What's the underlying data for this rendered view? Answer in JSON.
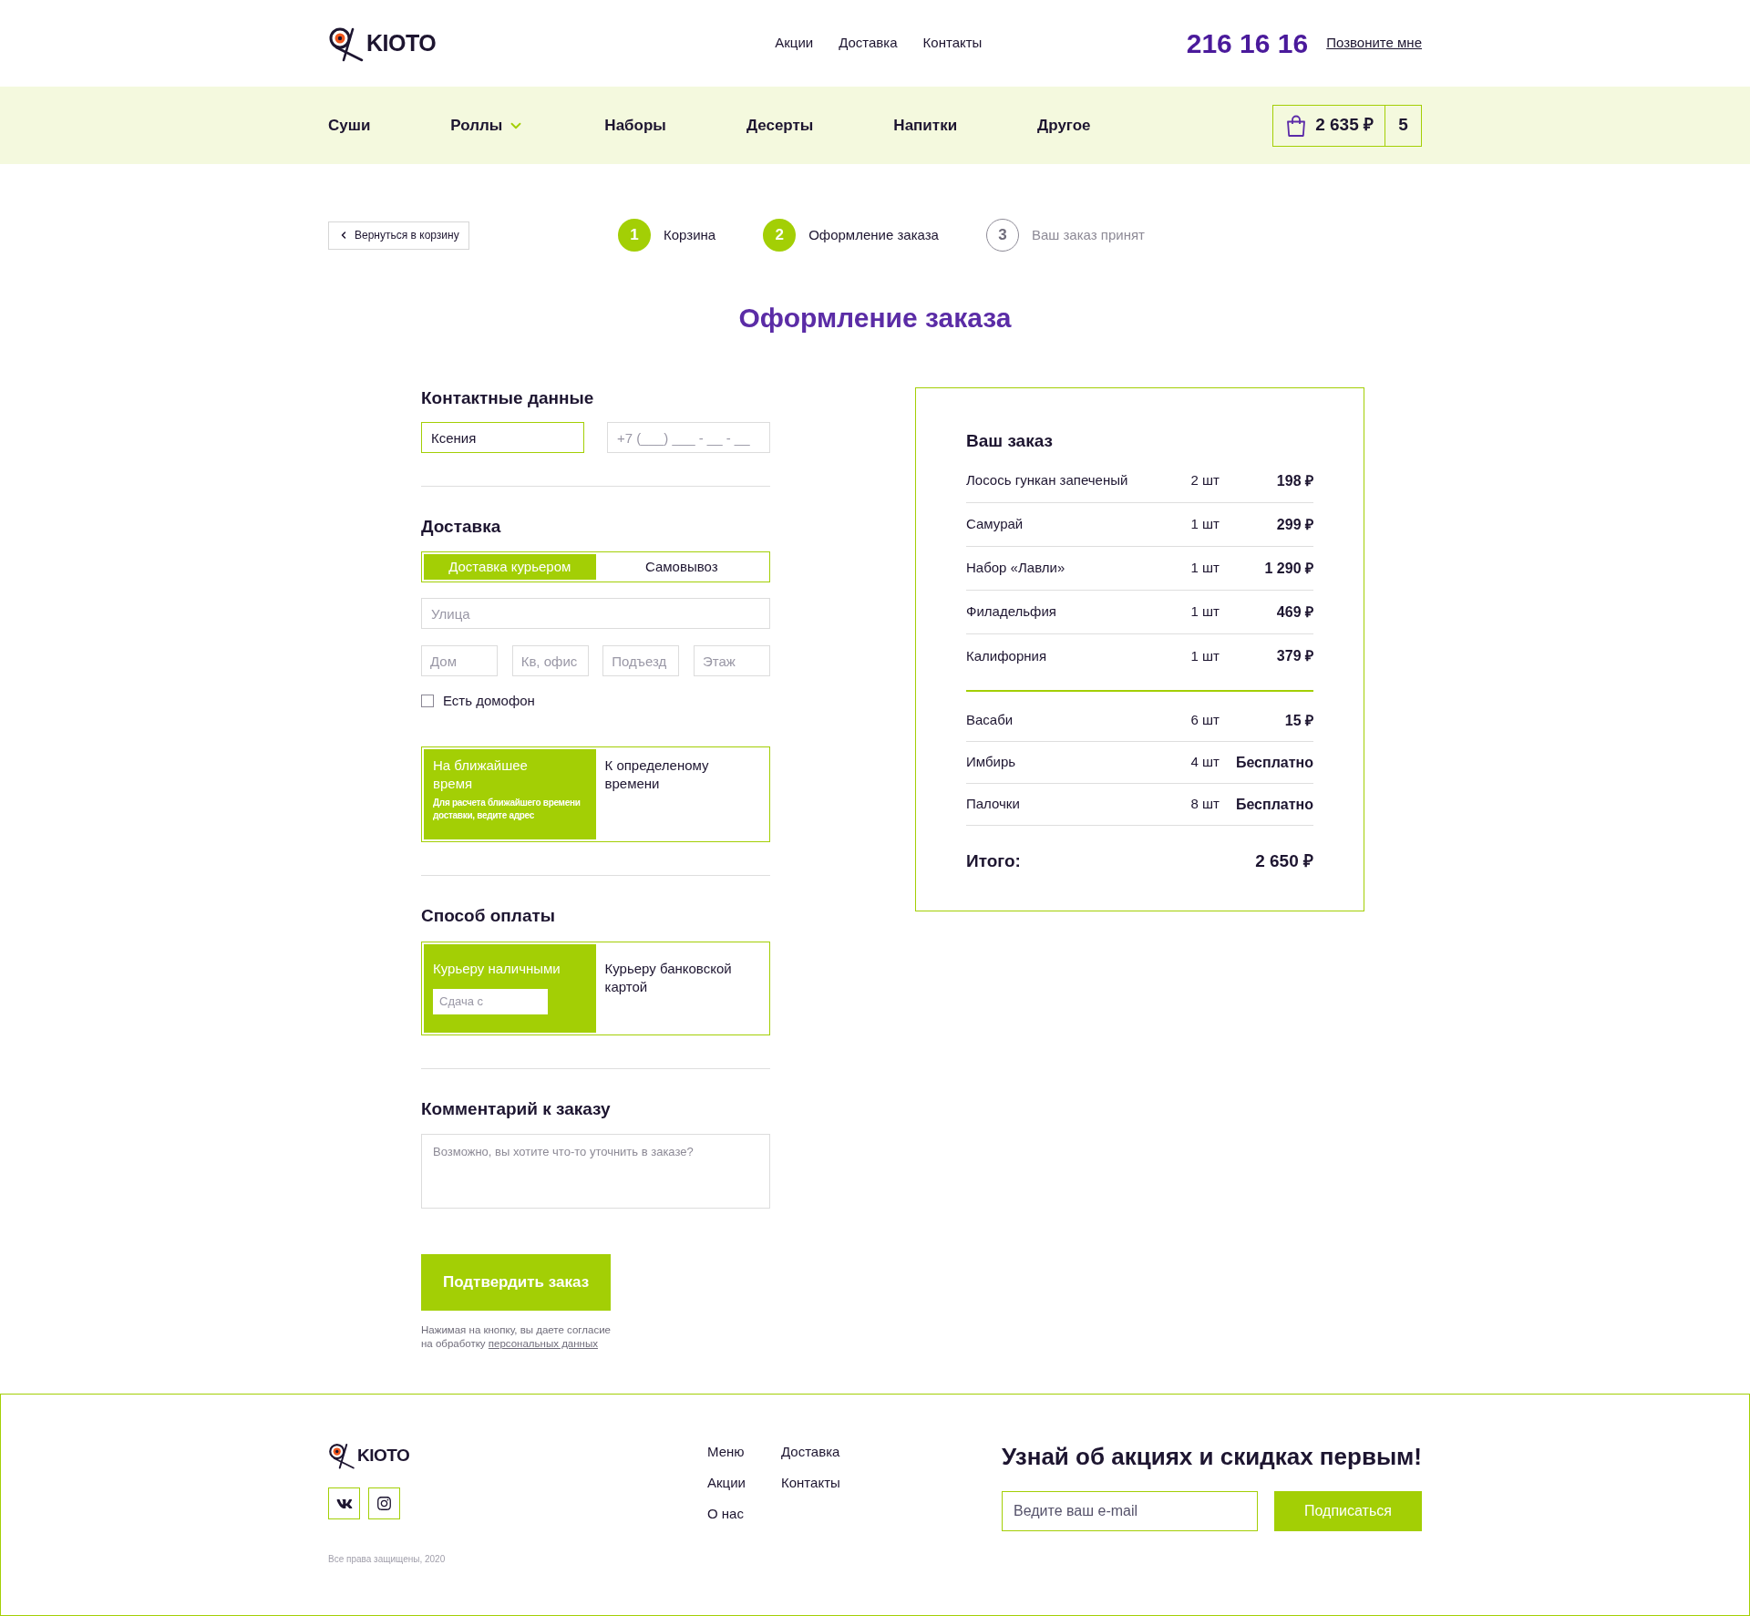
{
  "header": {
    "logo": "KIOTO",
    "nav": [
      "Акции",
      "Доставка",
      "Контакты"
    ],
    "phone": "216 16 16",
    "callback_link": "Позвоните мне"
  },
  "categories": [
    {
      "label": "Суши",
      "has_dropdown": false
    },
    {
      "label": "Роллы",
      "has_dropdown": true
    },
    {
      "label": "Наборы",
      "has_dropdown": false
    },
    {
      "label": "Десерты",
      "has_dropdown": false
    },
    {
      "label": "Напитки",
      "has_dropdown": false
    },
    {
      "label": "Другое",
      "has_dropdown": false
    }
  ],
  "cart": {
    "total": "2 635 ₽",
    "count": "5"
  },
  "back_button": "Вернуться в корзину",
  "steps": [
    {
      "number": "1",
      "label": "Корзина",
      "reached": true
    },
    {
      "number": "2",
      "label": "Оформление заказа",
      "reached": true
    },
    {
      "number": "3",
      "label": "Ваш заказ принят",
      "reached": false
    }
  ],
  "title": "Оформление заказа",
  "contact": {
    "heading": "Контактные данные",
    "name_field": {
      "value": "Ксения",
      "active": true
    },
    "phone_field": {
      "placeholder": "+7 (___) ___ - __ - __",
      "active": false
    }
  },
  "delivery": {
    "heading": "Доставка",
    "methods": [
      {
        "label": "Доставка курьером",
        "selected": true
      },
      {
        "label": "Самовывоз",
        "selected": false
      }
    ],
    "street": {
      "placeholder": "Улица"
    },
    "address_fields": [
      {
        "placeholder": "Дом"
      },
      {
        "placeholder": "Кв, офис"
      },
      {
        "placeholder": "Подъезд"
      },
      {
        "placeholder": "Этаж"
      }
    ],
    "intercom": {
      "label": "Есть домофон",
      "checked": false
    },
    "time_options": [
      {
        "label": "На ближайшее время",
        "hint": "Для расчета ближайшего времени доставки, ведите адрес",
        "selected": true
      },
      {
        "label": "К определеному времени",
        "selected": false
      }
    ]
  },
  "payment": {
    "heading": "Способ оплаты",
    "options": [
      {
        "label": "Курьеру наличными",
        "selected": true,
        "change_placeholder": "Сдача с"
      },
      {
        "label": "Курьеру банковской картой",
        "selected": false
      }
    ]
  },
  "comment": {
    "heading": "Комментарий к заказу",
    "placeholder": "Возможно, вы хотите что-то уточнить в заказе?"
  },
  "submit_button": "Подтвердить заказ",
  "consent": {
    "text": "Нажимая на кнопку, вы даете согласие на обработку",
    "link": "персональных данных"
  },
  "order": {
    "heading": "Ваш заказ",
    "items": [
      {
        "name": "Лосось гункан запеченый",
        "quantity": "2 шт",
        "price": "198 ₽"
      },
      {
        "name": "Самурай",
        "quantity": "1 шт",
        "price": "299 ₽"
      },
      {
        "name": "Набор «Лавли»",
        "quantity": "1 шт",
        "price": "1 290 ₽"
      },
      {
        "name": "Филадельфия",
        "quantity": "1 шт",
        "price": "469 ₽"
      },
      {
        "name": "Калифорния",
        "quantity": "1 шт",
        "price": "379 ₽"
      }
    ],
    "extras": [
      {
        "name": "Васаби",
        "quantity": "6 шт",
        "price": "15 ₽"
      },
      {
        "name": "Имбирь",
        "quantity": "4 шт",
        "price": "Бесплатно"
      },
      {
        "name": "Палочки",
        "quantity": "8 шт",
        "price": "Бесплатно"
      }
    ],
    "total_label": "Итого:",
    "total": "2 650 ₽"
  },
  "footer": {
    "logo": "KIOTO",
    "copyright": "Все права защищены, 2020",
    "link_columns": [
      {
        "links": [
          "Меню",
          "Акции",
          "О нас"
        ]
      },
      {
        "links": [
          "Доставка",
          "Контакты"
        ]
      }
    ],
    "subscribe": {
      "heading": "Узнай об акциях и скидках первым!",
      "email_placeholder": "Ведите ваш e-mail",
      "button": "Подписаться"
    }
  }
}
